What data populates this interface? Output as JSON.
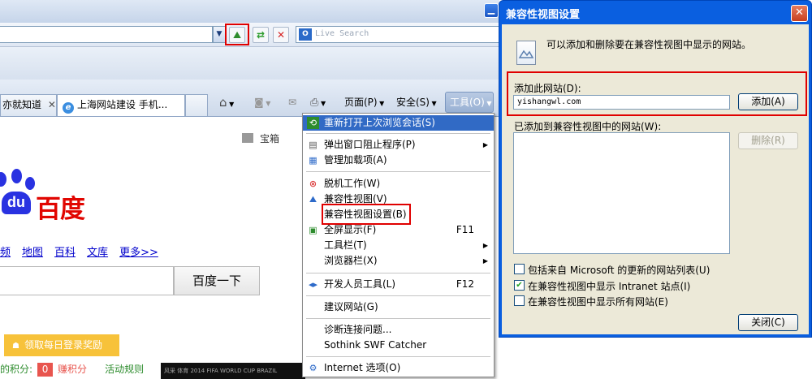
{
  "browser": {
    "search_placeholder": "Live Search",
    "tabs": [
      {
        "label": "亦就知道"
      },
      {
        "label": "上海网站建设 手机..."
      }
    ],
    "command_bar": {
      "page": "页面(P)",
      "safety": "安全(S)",
      "tools": "工具(O)"
    }
  },
  "baidu": {
    "logo_du": "du",
    "logo_cn": "百度",
    "treasure": "宝箱",
    "nav_links": [
      "频",
      "地图",
      "百科",
      "文库",
      "更多>>"
    ],
    "search_button": "百度一下",
    "daily_bonus": "领取每日登录奖励",
    "points_label": "的积分:",
    "points_value": "0",
    "earn_points": "赚积分",
    "activity_rules": "活动规则",
    "banner_text": "风采 体育 2014 FIFA WORLD CUP BRAZIL"
  },
  "tools_menu": {
    "items": [
      {
        "label": "重新打开上次浏览会话(S)",
        "accel": "",
        "submenu": false,
        "icon": "reopen-icon"
      },
      {
        "label": "弹出窗口阻止程序(P)",
        "accel": "",
        "submenu": true,
        "icon": "popup-blocker-icon"
      },
      {
        "label": "管理加载项(A)",
        "accel": "",
        "submenu": false,
        "icon": "addons-icon"
      },
      {
        "label": "脱机工作(W)",
        "accel": "",
        "submenu": false,
        "icon": "offline-icon"
      },
      {
        "label": "兼容性视图(V)",
        "accel": "",
        "submenu": false,
        "icon": "compat-view-icon"
      },
      {
        "label": "兼容性视图设置(B)",
        "accel": "",
        "submenu": false,
        "icon": ""
      },
      {
        "label": "全屏显示(F)",
        "accel": "F11",
        "submenu": false,
        "icon": "fullscreen-icon"
      },
      {
        "label": "工具栏(T)",
        "accel": "",
        "submenu": true,
        "icon": ""
      },
      {
        "label": "浏览器栏(X)",
        "accel": "",
        "submenu": true,
        "icon": ""
      },
      {
        "label": "开发人员工具(L)",
        "accel": "F12",
        "submenu": false,
        "icon": "devtools-icon"
      },
      {
        "label": "建议网站(G)",
        "accel": "",
        "submenu": false,
        "icon": ""
      },
      {
        "label": "诊断连接问题...",
        "accel": "",
        "submenu": false,
        "icon": ""
      },
      {
        "label": "Sothink SWF Catcher",
        "accel": "",
        "submenu": false,
        "icon": ""
      },
      {
        "label": "Internet 选项(O)",
        "accel": "",
        "submenu": false,
        "icon": "internet-options-icon"
      }
    ]
  },
  "dialog": {
    "title": "兼容性视图设置",
    "intro": "可以添加和删除要在兼容性视图中显示的网站。",
    "add_label": "添加此网站(D):",
    "add_value": "yishangwl.com",
    "add_button": "添加(A)",
    "list_label": "已添加到兼容性视图中的网站(W):",
    "remove_button": "删除(R)",
    "checkboxes": [
      {
        "label": "包括来自 Microsoft 的更新的网站列表(U)",
        "checked": false
      },
      {
        "label": "在兼容性视图中显示 Intranet 站点(I)",
        "checked": true
      },
      {
        "label": "在兼容性视图中显示所有网站(E)",
        "checked": false
      }
    ],
    "close_button": "关闭(C)"
  },
  "colors": {
    "highlight": "#316ac5",
    "annotation_red": "#e00000",
    "baidu_blue": "#2932e1",
    "baidu_red": "#e10601",
    "xp_title_blue": "#0a5fe0",
    "dialog_face": "#ece9d8"
  }
}
